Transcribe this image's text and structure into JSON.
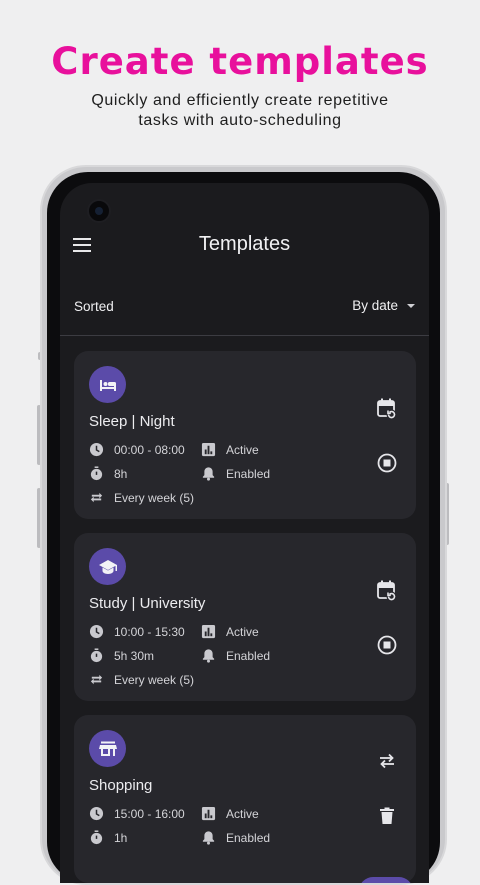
{
  "promo": {
    "title": "Create templates",
    "subtitle_line1": "Quickly and efficiently create repetitive",
    "subtitle_line2": "tasks with auto-scheduling"
  },
  "app": {
    "title": "Templates",
    "sort_label": "Sorted",
    "sort_value": "By date"
  },
  "colors": {
    "accent": "#e8109c",
    "icon_bg": "#5b4ba9",
    "card_bg": "#27272c",
    "screen_bg": "#1b1b1e"
  },
  "templates": [
    {
      "icon": "bed-icon",
      "title": "Sleep | Night",
      "time": "00:00 - 08:00",
      "status": "Active",
      "duration": "8h",
      "notifications": "Enabled",
      "repeat": "Every week (5)",
      "action_primary": "calendar-sync-icon",
      "action_secondary": "stop-circle-icon"
    },
    {
      "icon": "school-icon",
      "title": "Study | University",
      "time": "10:00 - 15:30",
      "status": "Active",
      "duration": "5h 30m",
      "notifications": "Enabled",
      "repeat": "Every week (5)",
      "action_primary": "calendar-sync-icon",
      "action_secondary": "stop-circle-icon"
    },
    {
      "icon": "store-icon",
      "title": "Shopping",
      "time": "15:00 - 16:00",
      "status": "Active",
      "duration": "1h",
      "notifications": "Enabled",
      "action_primary": "swap-icon",
      "action_secondary": "delete-icon"
    }
  ]
}
